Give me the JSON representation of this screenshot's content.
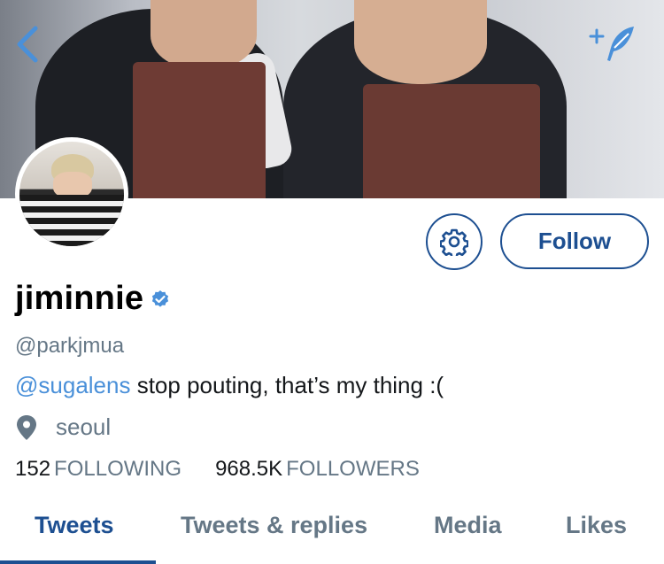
{
  "header": {
    "back_icon": "chevron-left-icon",
    "compose_icon": "feather-plus-icon",
    "accent_color": "#4a90d9"
  },
  "profile": {
    "name": "jiminnie",
    "verified": true,
    "handle": "@parkjmua",
    "bio_mention": "@sugalens",
    "bio_text": " stop pouting, that’s my thing :(",
    "location": "seoul"
  },
  "actions": {
    "settings_icon": "gear-icon",
    "follow_label": "Follow"
  },
  "stats": {
    "following_count": "152",
    "following_label": "FOLLOWING",
    "followers_count": "968.5K",
    "followers_label": "FOLLOWERS"
  },
  "tabs": [
    {
      "label": "Tweets",
      "active": true
    },
    {
      "label": "Tweets & replies",
      "active": false
    },
    {
      "label": "Media",
      "active": false
    },
    {
      "label": "Likes",
      "active": false
    }
  ],
  "colors": {
    "primary": "#1d4f91",
    "link": "#4a90d9",
    "secondary_text": "#657786"
  }
}
